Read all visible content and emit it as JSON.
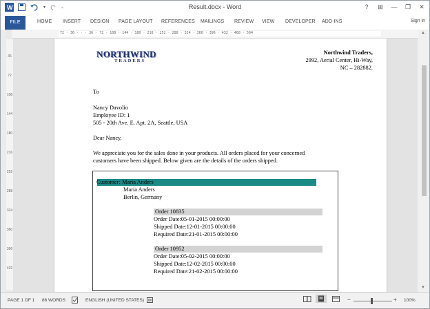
{
  "window": {
    "title": "Result.docx - Word"
  },
  "ribbon": {
    "file_tab": "FILE",
    "tabs": [
      "HOME",
      "INSERT",
      "DESIGN",
      "PAGE LAYOUT",
      "REFERENCES",
      "MAILINGS",
      "REVIEW",
      "VIEW",
      "DEVELOPER",
      "ADD-INS"
    ],
    "sign_in": "Sign in"
  },
  "ruler": {
    "horizontal_text": "72 · 36 · · · 36 · 72 · 108 · 144 · 180 · 216 · 252 · 288 · 324 · 360 · 396 · 432 · 468 · 504",
    "vertical_numbers": [
      "36",
      "72",
      "108",
      "144",
      "180",
      "216",
      "252",
      "288",
      "324",
      "360",
      "396",
      "432"
    ]
  },
  "document": {
    "logo": {
      "line1": "NORTHWIND",
      "line2": "TRADERS"
    },
    "company_address": [
      "Northwind Traders,",
      "2992, Aerial Center, Hi-Way,",
      "NC – 282882."
    ],
    "to_label": "To",
    "recipient": [
      "Nancy Davolio",
      "Employee ID: 1",
      "505 - 20th Ave. E. Apt. 2A, Seattle, USA"
    ],
    "salutation": "Dear Nancy,",
    "body_lines": [
      "We appreciate you for the sales done in your products. All orders placed for your concerned",
      "customers have been shipped. Below given are the details of the orders shipped."
    ],
    "customer": {
      "heading": "Customer: Maria Anders",
      "name": "Maria Anders",
      "location": "Berlin, Germany"
    },
    "orders": [
      {
        "title": "Order 10835",
        "order_date": "Order Date:05-01-2015 00:00:00",
        "shipped_date": "Shipped Date:12-01-2015 00:00:00",
        "required_date": "Required Date:21-01-2015 00:00:00"
      },
      {
        "title": "Order 10952",
        "order_date": "Order Date:05-02-2015 00:00:00",
        "shipped_date": "Shipped Date:12-02-2015 00:00:00",
        "required_date": "Required Date:21-02-2015 00:00:00"
      }
    ]
  },
  "status_bar": {
    "page": "PAGE 1 OF 1",
    "words": "86 WORDS",
    "language": "ENGLISH (UNITED STATES)",
    "zoom_minus": "−",
    "zoom_plus": "+",
    "zoom": "100%"
  },
  "colors": {
    "accent": "#2b579a",
    "customer_bar": "#1a8a87",
    "order_bar": "#d3d3d3"
  }
}
